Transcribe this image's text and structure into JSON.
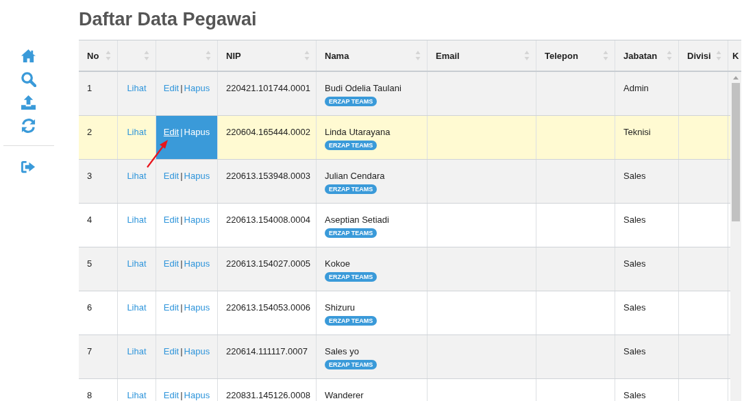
{
  "title": "Daftar Data Pegawai",
  "sidebar": {
    "items": [
      {
        "kind": "home"
      },
      {
        "kind": "search"
      },
      {
        "kind": "upload"
      },
      {
        "kind": "refresh"
      },
      {
        "kind": "divider"
      },
      {
        "kind": "logout"
      }
    ]
  },
  "table": {
    "columns": [
      {
        "label": "No",
        "sortable": true
      },
      {
        "sortable": true
      },
      {
        "sortable": true
      },
      {
        "label": "NIP",
        "sortable": true
      },
      {
        "label": "Nama",
        "sortable": true
      },
      {
        "label": "Email",
        "sortable": true
      },
      {
        "label": "Telepon",
        "sortable": true
      },
      {
        "label": "Jabatan",
        "sortable": true
      },
      {
        "label": "Divisi",
        "sortable": true
      },
      {
        "label": "K"
      }
    ],
    "rows": [
      {
        "no": "1",
        "view": "Lihat",
        "edit": "Edit",
        "separator": "|",
        "delete": "Hapus",
        "nip": "220421.101744.0001",
        "name": "Budi Odelia Taulani",
        "team": "ERZAP TEAMS",
        "position": "Admin",
        "selected": false,
        "edit_hover": false
      },
      {
        "no": "2",
        "view": "Lihat",
        "edit": "Edit",
        "separator": "|",
        "delete": "Hapus",
        "nip": "220604.165444.0002",
        "name": "Linda Utarayana",
        "team": "ERZAP TEAMS",
        "position": "Teknisi",
        "selected": true,
        "edit_hover": true,
        "pointer_arrow": true
      },
      {
        "no": "3",
        "view": "Lihat",
        "edit": "Edit",
        "separator": "|",
        "delete": "Hapus",
        "nip": "220613.153948.0003",
        "name": "Julian Cendara",
        "team": "ERZAP TEAMS",
        "position": "Sales",
        "selected": false,
        "edit_hover": false
      },
      {
        "no": "4",
        "view": "Lihat",
        "edit": "Edit",
        "separator": "|",
        "delete": "Hapus",
        "nip": "220613.154008.0004",
        "name": "Aseptian Setiadi",
        "team": "ERZAP TEAMS",
        "position": "Sales",
        "selected": false,
        "edit_hover": false
      },
      {
        "no": "5",
        "view": "Lihat",
        "edit": "Edit",
        "separator": "|",
        "delete": "Hapus",
        "nip": "220613.154027.0005",
        "name": "Kokoe",
        "team": "ERZAP TEAMS",
        "position": "Sales",
        "selected": false,
        "edit_hover": false
      },
      {
        "no": "6",
        "view": "Lihat",
        "edit": "Edit",
        "separator": "|",
        "delete": "Hapus",
        "nip": "220613.154053.0006",
        "name": "Shizuru",
        "team": "ERZAP TEAMS",
        "position": "Sales",
        "selected": false,
        "edit_hover": false
      },
      {
        "no": "7",
        "view": "Lihat",
        "edit": "Edit",
        "separator": "|",
        "delete": "Hapus",
        "nip": "220614.111117.0007",
        "name": "Sales yo",
        "team": "ERZAP TEAMS",
        "position": "Sales",
        "selected": false,
        "edit_hover": false
      },
      {
        "no": "8",
        "view": "Lihat",
        "edit": "Edit",
        "separator": "|",
        "delete": "Hapus",
        "nip": "220831.145126.0008",
        "name": "Wanderer",
        "position": "Sales",
        "selected": false,
        "edit_hover": false
      }
    ]
  }
}
